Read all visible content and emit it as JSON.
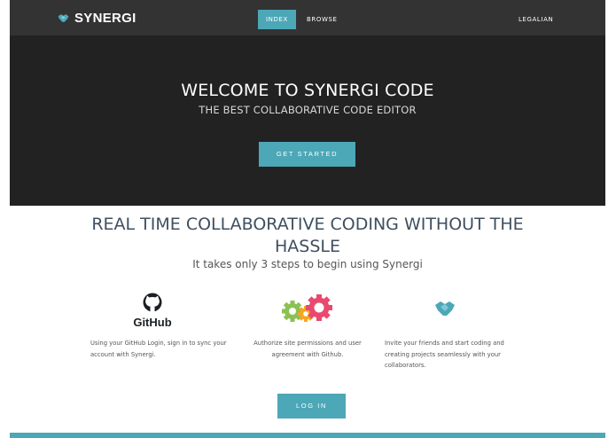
{
  "nav": {
    "brand": "SYNERGI",
    "items": [
      {
        "label": "INDEX",
        "active": true
      },
      {
        "label": "BROWSE",
        "active": false
      }
    ],
    "user": "LEGALIAN"
  },
  "hero": {
    "title": "WELCOME TO SYNERGI CODE",
    "subtitle": "THE BEST COLLABORATIVE CODE EDITOR",
    "cta_label": "GET STARTED"
  },
  "features": {
    "title": "REAL TIME COLLABORATIVE CODING WITHOUT THE HASSLE",
    "subtitle": "It takes only 3 steps to begin using Synergi",
    "github_wordmark": "GitHub",
    "items": [
      {
        "icon": "github-icon",
        "text": "Using your GitHub Login, sign in to sync your account with Synergi."
      },
      {
        "icon": "gears-icon",
        "text": "Authorize site permissions and user agreement with Github."
      },
      {
        "icon": "handshake-icon",
        "text": "Invite your friends and start coding and creating projects seamlessly with your collaborators."
      }
    ],
    "login_label": "LOG IN"
  },
  "colors": {
    "accent": "#4ca7b7",
    "nav_bg": "#333333",
    "hero_bg": "#222222",
    "heading": "#3f4f5f",
    "gear_green": "#8cc152",
    "gear_orange": "#f6a623",
    "gear_pink": "#e84a6f"
  }
}
